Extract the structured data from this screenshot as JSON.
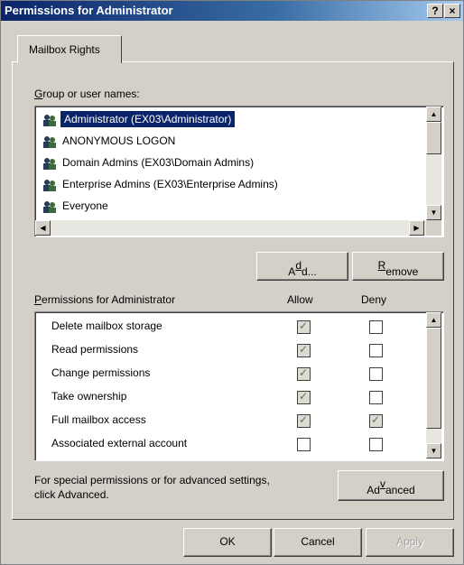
{
  "window": {
    "title": "Permissions for Administrator",
    "help_glyph": "?",
    "close_glyph": "×"
  },
  "tabs": [
    {
      "label": "Mailbox Rights"
    }
  ],
  "group_section": {
    "label_prefix": "G",
    "label_rest": "roup or user names:",
    "users": [
      {
        "name": "Administrator (EX03\\Administrator)",
        "selected": true,
        "icon": "user-group-icon"
      },
      {
        "name": "ANONYMOUS LOGON",
        "selected": false,
        "icon": "user-group-icon"
      },
      {
        "name": "Domain Admins (EX03\\Domain Admins)",
        "selected": false,
        "icon": "user-group-icon"
      },
      {
        "name": "Enterprise Admins (EX03\\Enterprise Admins)",
        "selected": false,
        "icon": "user-group-icon"
      },
      {
        "name": "Everyone",
        "selected": false,
        "icon": "user-group-icon"
      }
    ]
  },
  "buttons": {
    "add_pre": "A",
    "add_ul": "d",
    "add_post": "d...",
    "remove_ul": "R",
    "remove_post": "emove",
    "advanced_pre": "Ad",
    "advanced_ul": "v",
    "advanced_post": "anced",
    "ok": "OK",
    "cancel": "Cancel",
    "apply": "Apply"
  },
  "permissions": {
    "label_ul": "P",
    "label_rest": "ermissions for Administrator",
    "allow_header": "Allow",
    "deny_header": "Deny",
    "items": [
      {
        "name": "Delete mailbox storage",
        "allow": true,
        "deny": false
      },
      {
        "name": "Read permissions",
        "allow": true,
        "deny": false
      },
      {
        "name": "Change permissions",
        "allow": true,
        "deny": false
      },
      {
        "name": "Take ownership",
        "allow": true,
        "deny": false
      },
      {
        "name": "Full mailbox access",
        "allow": true,
        "deny": true
      },
      {
        "name": "Associated external account",
        "allow": false,
        "deny": false
      }
    ]
  },
  "special_note": {
    "line1": "For special permissions or for advanced settings,",
    "line2": "click Advanced."
  },
  "colors": {
    "titlebar_start": "#0a246a",
    "titlebar_end": "#a6caf0",
    "dialog_bg": "#d4d0c8",
    "selection": "#0a246a"
  }
}
